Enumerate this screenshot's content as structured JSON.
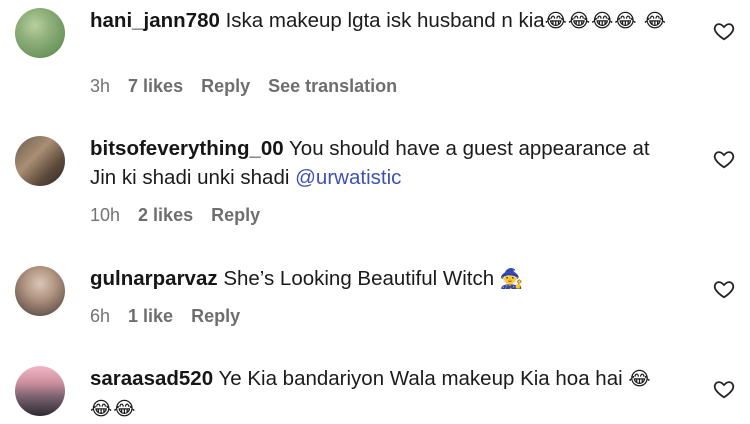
{
  "comments": [
    {
      "username": "hani_jann780",
      "text": "Iska makeup lgta isk husband n kia",
      "emoji": "😂😂😂😂 😂",
      "time": "3h",
      "likes": "7 likes",
      "reply": "Reply",
      "translation": "See translation"
    },
    {
      "username": "bitsofeverything_00",
      "text": "You should have a guest appearance at Jin ki shadi unki shadi",
      "mention": "@urwatistic",
      "time": "10h",
      "likes": "2 likes",
      "reply": "Reply"
    },
    {
      "username": "gulnarparvaz",
      "text": "She’s Looking Beautiful Witch",
      "emoji": "🧙",
      "time": "6h",
      "likes": "1 like",
      "reply": "Reply"
    },
    {
      "username": "saraasad520",
      "text": "Ye Kia bandariyon Wala makeup Kia hoa hai",
      "emoji": "😂 😂😂",
      "time": "",
      "likes": "",
      "reply": ""
    }
  ]
}
